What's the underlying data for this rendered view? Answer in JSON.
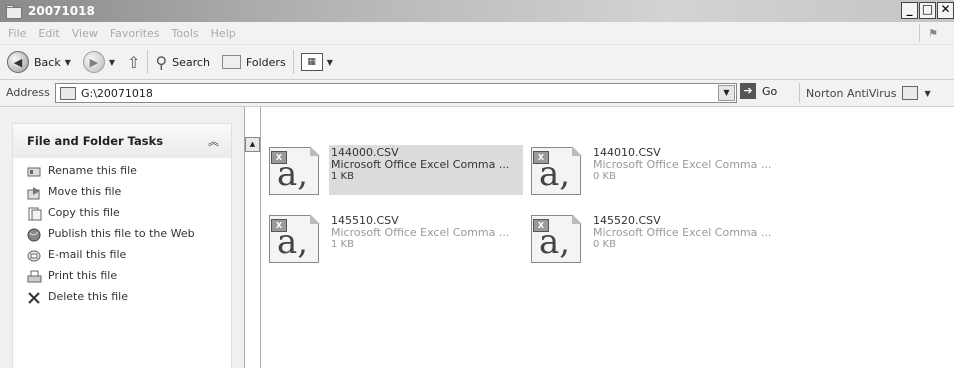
{
  "window": {
    "title": "20071018"
  },
  "menu": [
    "File",
    "Edit",
    "View",
    "Favorites",
    "Tools",
    "Help"
  ],
  "toolbar": {
    "back_label": "Back",
    "search_label": "Search",
    "folders_label": "Folders"
  },
  "address": {
    "label": "Address",
    "value": "G:\\20071018",
    "go_label": "Go",
    "norton_label": "Norton AntiVirus"
  },
  "tasks": {
    "title": "File and Folder Tasks",
    "items": [
      {
        "label": "Rename this file",
        "icon": "rename-icon"
      },
      {
        "label": "Move this file",
        "icon": "move-icon"
      },
      {
        "label": "Copy this file",
        "icon": "copy-icon"
      },
      {
        "label": "Publish this file to the Web",
        "icon": "publish-web-icon"
      },
      {
        "label": "E-mail this file",
        "icon": "email-icon"
      },
      {
        "label": "Print this file",
        "icon": "print-icon"
      },
      {
        "label": "Delete this file",
        "icon": "delete-icon"
      }
    ]
  },
  "files": [
    {
      "name": "144000.CSV",
      "type": "Microsoft Office Excel Comma ...",
      "size": "1 KB",
      "selected": true
    },
    {
      "name": "144010.CSV",
      "type": "Microsoft Office Excel Comma ...",
      "size": "0 KB",
      "selected": false
    },
    {
      "name": "145510.CSV",
      "type": "Microsoft Office Excel Comma ...",
      "size": "1 KB",
      "selected": false
    },
    {
      "name": "145520.CSV",
      "type": "Microsoft Office Excel Comma ...",
      "size": "0 KB",
      "selected": false
    }
  ],
  "colors": {
    "titlebar": "#9a9a9a",
    "selection": "#dcdcdc",
    "pane_bg": "#f0f0f0"
  }
}
